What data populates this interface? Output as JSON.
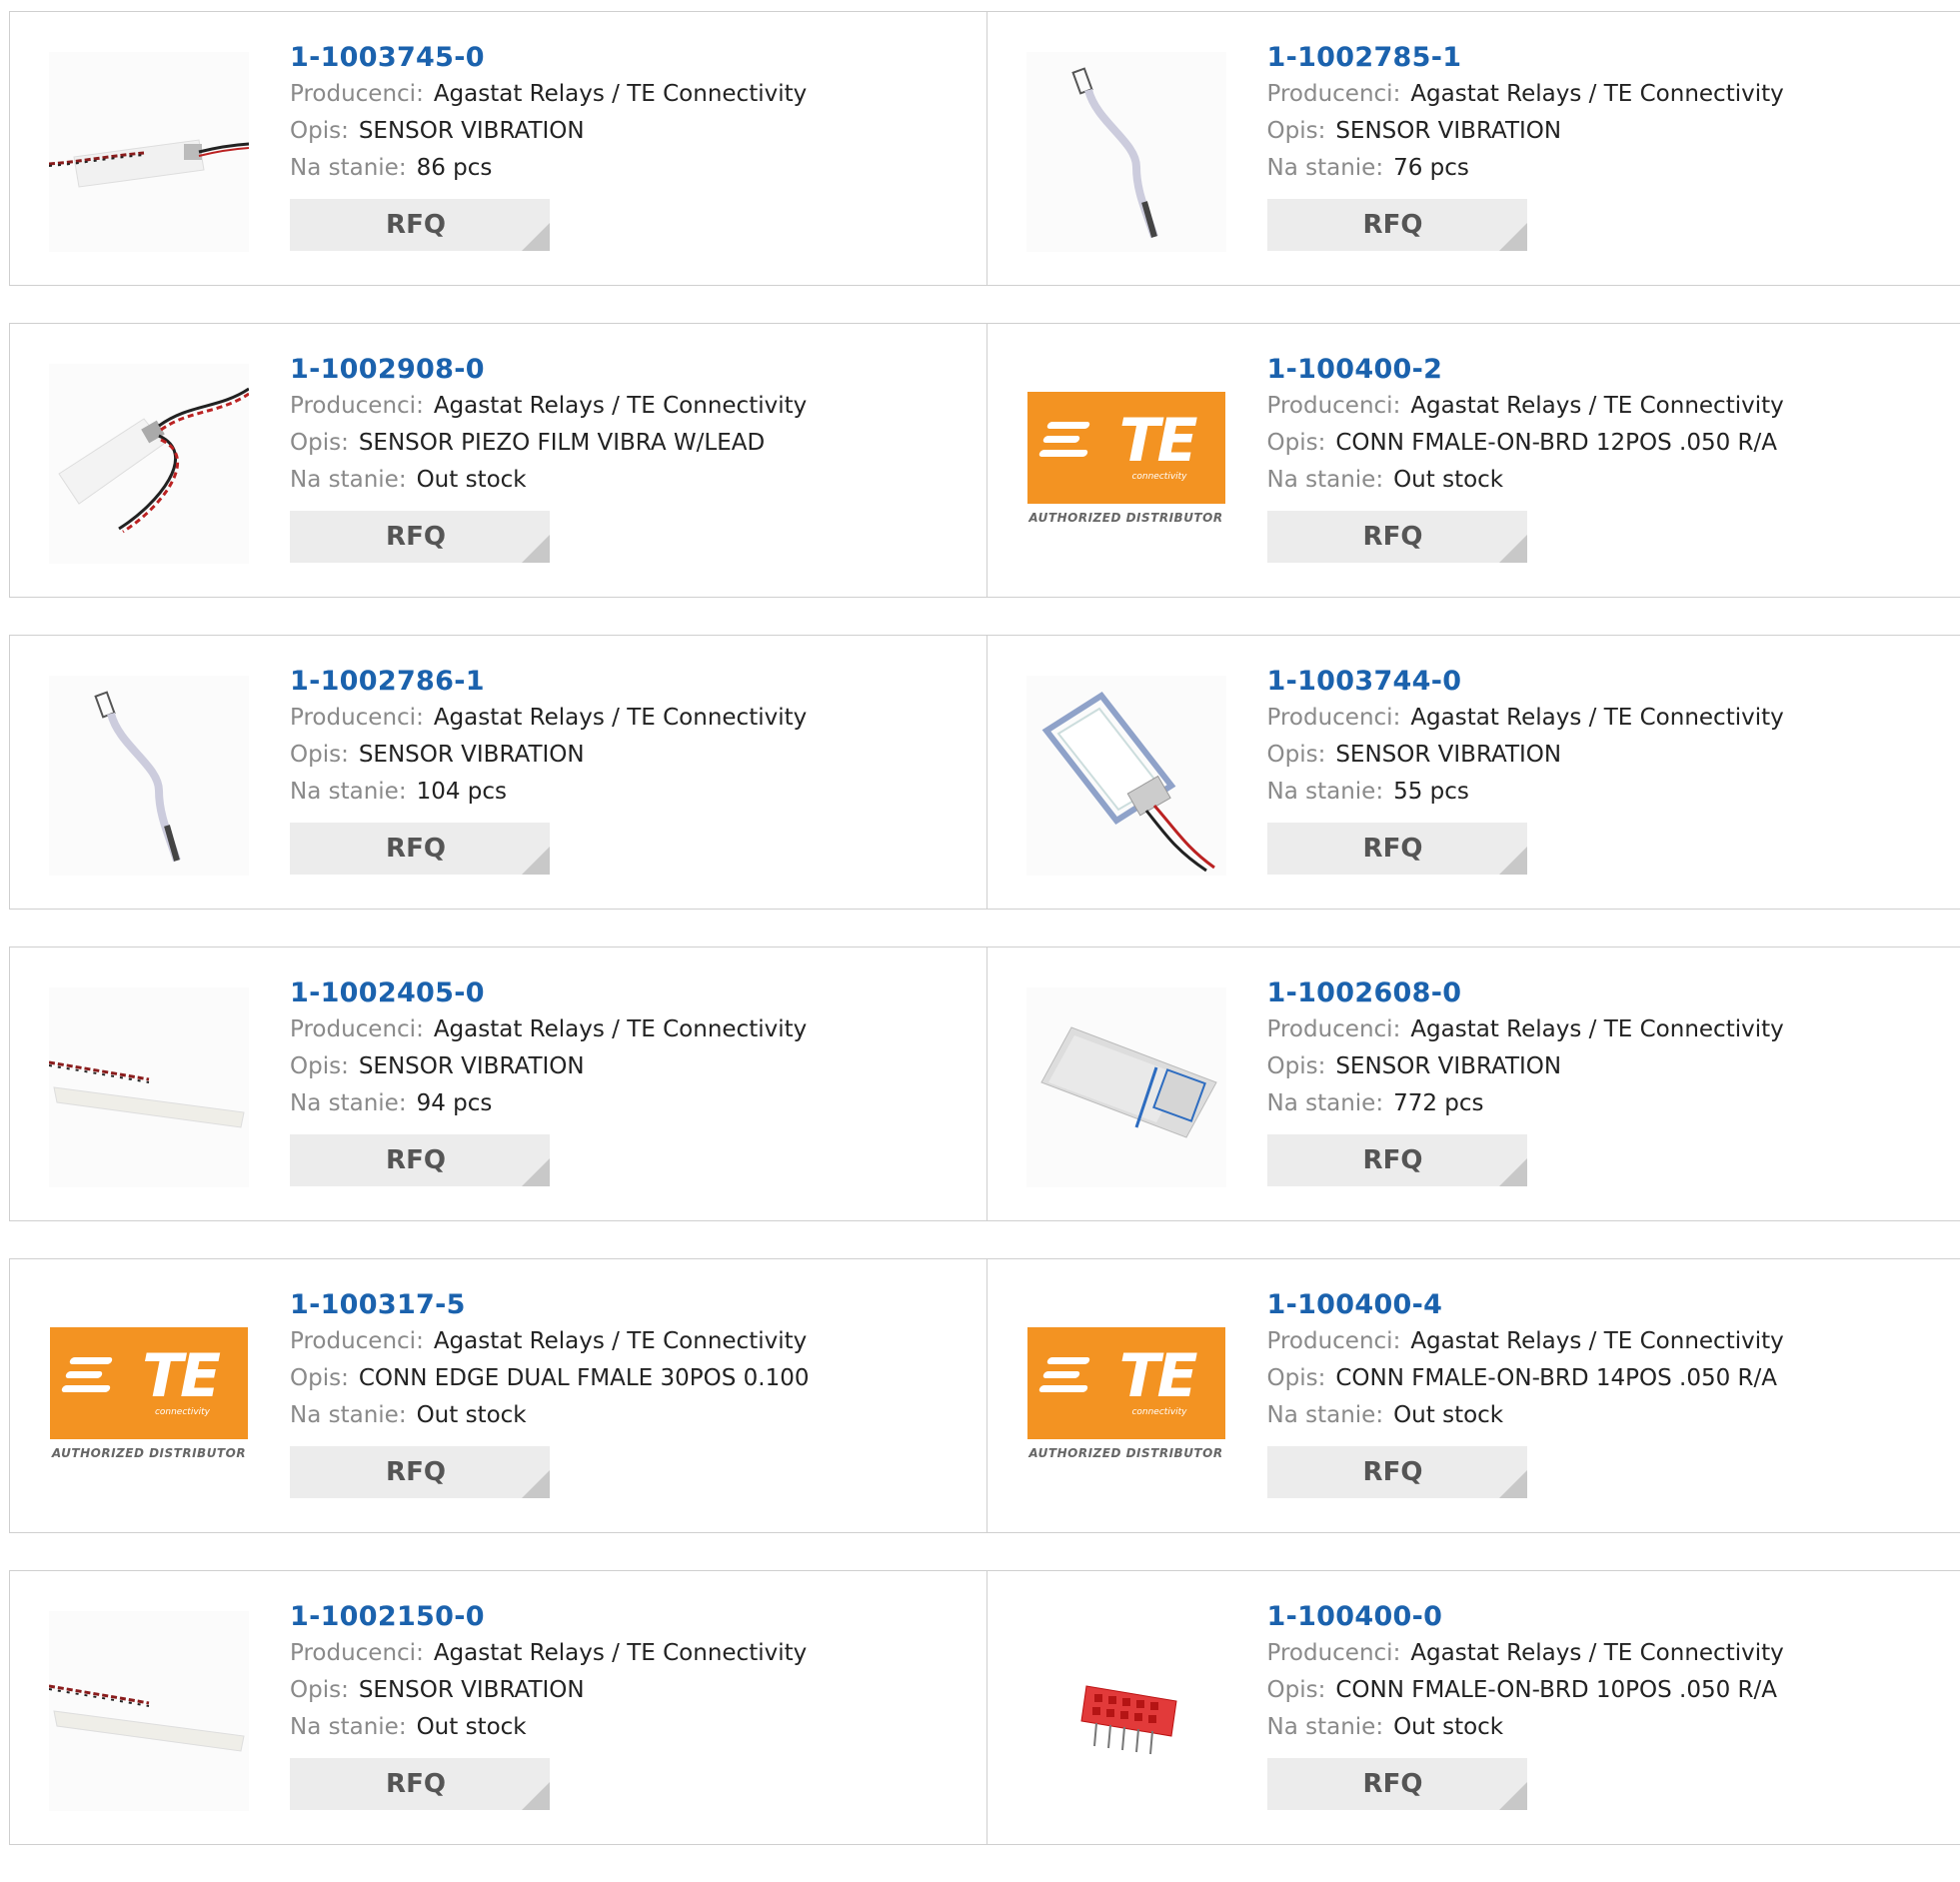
{
  "labels": {
    "manufacturer": "Producenci:",
    "description": "Opis:",
    "stock": "Na stanie:",
    "rfq": "RFQ"
  },
  "brand": {
    "te_text": "TE",
    "te_sub": "connectivity",
    "authorized": "AUTHORIZED DISTRIBUTOR",
    "accent": "#f39322",
    "link_color": "#1b62ad"
  },
  "products": [
    {
      "pn": "1-1003745-0",
      "manufacturer": "Agastat Relays / TE Connectivity",
      "description": "SENSOR VIBRATION",
      "stock": "86 pcs",
      "image": "sensor-strip-wires"
    },
    {
      "pn": "1-1002785-1",
      "manufacturer": "Agastat Relays / TE Connectivity",
      "description": "SENSOR VIBRATION",
      "stock": "76 pcs",
      "image": "sensor-probe"
    },
    {
      "pn": "1-1002908-0",
      "manufacturer": "Agastat Relays / TE Connectivity",
      "description": "SENSOR PIEZO FILM VIBRA W/LEAD",
      "stock": "Out stock",
      "image": "sensor-film-leads"
    },
    {
      "pn": "1-100400-2",
      "manufacturer": "Agastat Relays / TE Connectivity",
      "description": "CONN FMALE-ON-BRD 12POS .050 R/A",
      "stock": "Out stock",
      "image": "te-logo"
    },
    {
      "pn": "1-1002786-1",
      "manufacturer": "Agastat Relays / TE Connectivity",
      "description": "SENSOR VIBRATION",
      "stock": "104 pcs",
      "image": "sensor-probe"
    },
    {
      "pn": "1-1003744-0",
      "manufacturer": "Agastat Relays / TE Connectivity",
      "description": "SENSOR VIBRATION",
      "stock": "55 pcs",
      "image": "sensor-frame"
    },
    {
      "pn": "1-1002405-0",
      "manufacturer": "Agastat Relays / TE Connectivity",
      "description": "SENSOR VIBRATION",
      "stock": "94 pcs",
      "image": "sensor-long-strip"
    },
    {
      "pn": "1-1002608-0",
      "manufacturer": "Agastat Relays / TE Connectivity",
      "description": "SENSOR VIBRATION",
      "stock": "772 pcs",
      "image": "sensor-pad"
    },
    {
      "pn": "1-100317-5",
      "manufacturer": "Agastat Relays / TE Connectivity",
      "description": "CONN EDGE DUAL FMALE 30POS 0.100",
      "stock": "Out stock",
      "image": "te-logo"
    },
    {
      "pn": "1-100400-4",
      "manufacturer": "Agastat Relays / TE Connectivity",
      "description": "CONN FMALE-ON-BRD 14POS .050 R/A",
      "stock": "Out stock",
      "image": "te-logo"
    },
    {
      "pn": "1-1002150-0",
      "manufacturer": "Agastat Relays / TE Connectivity",
      "description": "SENSOR VIBRATION",
      "stock": "Out stock",
      "image": "sensor-long-strip"
    },
    {
      "pn": "1-100400-0",
      "manufacturer": "Agastat Relays / TE Connectivity",
      "description": "CONN FMALE-ON-BRD 10POS .050 R/A",
      "stock": "Out stock",
      "image": "red-connector"
    }
  ]
}
